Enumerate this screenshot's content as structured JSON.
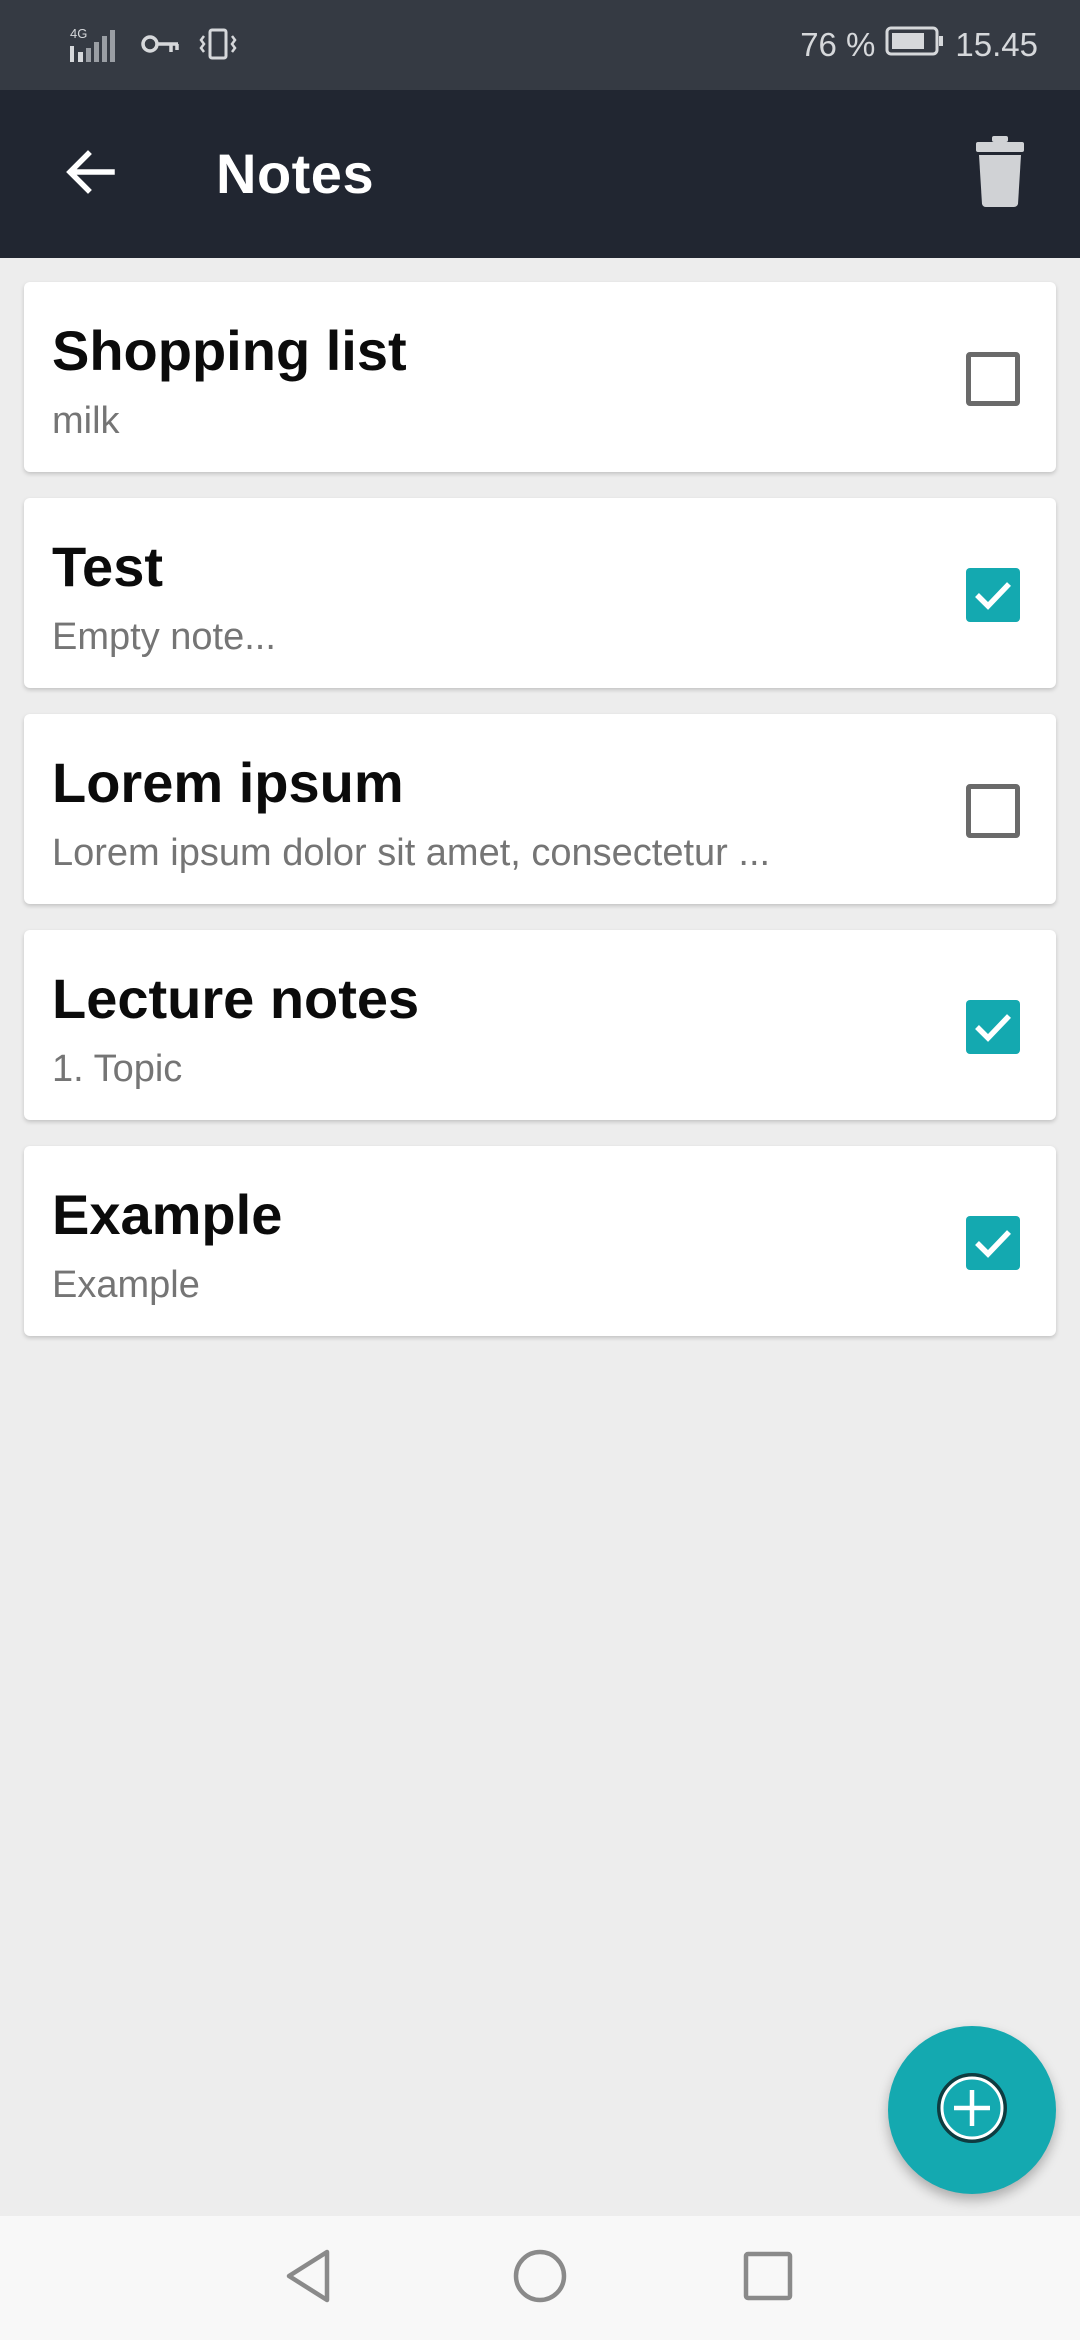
{
  "status_bar": {
    "network": "4G",
    "battery_percent": "76 %",
    "time": "15.45",
    "icons": [
      "signal-icon",
      "vpn-key-icon",
      "vibrate-icon",
      "battery-icon"
    ]
  },
  "app_bar": {
    "title": "Notes",
    "back_icon": "arrow-back-icon",
    "delete_icon": "trash-icon"
  },
  "notes": [
    {
      "title": "Shopping list",
      "preview": "milk",
      "checked": false
    },
    {
      "title": "Test",
      "preview": "Empty note...",
      "checked": true
    },
    {
      "title": "Lorem ipsum",
      "preview": "Lorem ipsum dolor sit amet, consectetur ...",
      "checked": false
    },
    {
      "title": "Lecture notes",
      "preview": "1. Topic",
      "checked": true
    },
    {
      "title": "Example",
      "preview": "Example",
      "checked": true
    }
  ],
  "fab": {
    "icon": "add-circle-icon"
  },
  "nav_bar": {
    "icons": [
      "nav-back-icon",
      "nav-home-icon",
      "nav-recents-icon"
    ]
  },
  "colors": {
    "accent": "#14a9b0",
    "app_bar": "#212631",
    "status_bar": "#353a43",
    "background": "#ededed"
  }
}
